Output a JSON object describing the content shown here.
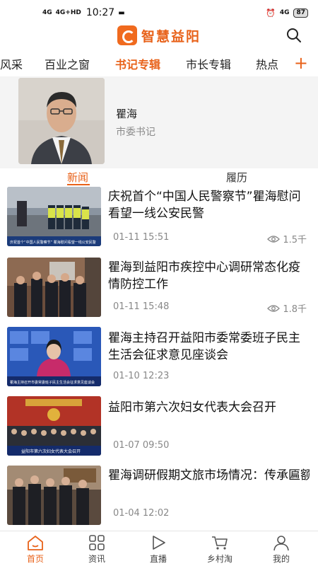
{
  "status_bar": {
    "signal_left": "4G",
    "signal_left2": "4G+HD",
    "time": "10:27",
    "network_right": "4G",
    "battery": "87"
  },
  "header": {
    "app_name": "智慧益阳"
  },
  "tabs": [
    {
      "label": "风采"
    },
    {
      "label": "百业之窗"
    },
    {
      "label": "书记专辑"
    },
    {
      "label": "市长专辑"
    },
    {
      "label": "热点"
    }
  ],
  "tab_add": "+",
  "profile": {
    "name": "瞿海",
    "role": "市委书记"
  },
  "subtabs": [
    {
      "label": "新闻"
    },
    {
      "label": "履历"
    }
  ],
  "news": [
    {
      "title": "庆祝首个“中国人民警察节”瞿海慰问看望一线公安民警",
      "date": "01-11 15:51",
      "views": "1.5千",
      "thumb_caption": "庆祝首个“中国人民警察节” 瞿海慰问看望一线公安民警"
    },
    {
      "title": "瞿海到益阳市疾控中心调研常态化疫情防控工作",
      "date": "01-11 15:48",
      "views": "1.8千"
    },
    {
      "title": "瞿海主持召开益阳市委常委班子民主生活会征求意见座谈会",
      "date": "01-10 12:23",
      "views": "",
      "thumb_caption": "瞿海主持召开市委常委班子民主生活会征求意见座谈会"
    },
    {
      "title": "益阳市第六次妇女代表大会召开",
      "date": "01-07 09:50",
      "views": "",
      "thumb_caption": "益阳市第六次妇女代表大会召开"
    },
    {
      "title": "瞿海调研假期文旅市场情况：传承匾额文化 为东部新区木…",
      "date": "01-04 12:02",
      "views": ""
    }
  ],
  "bottom_nav": [
    {
      "label": "首页"
    },
    {
      "label": "资讯"
    },
    {
      "label": "直播"
    },
    {
      "label": "乡村淘"
    },
    {
      "label": "我的"
    }
  ],
  "colors": {
    "accent": "#e8621a",
    "text": "#222222",
    "muted": "#888888"
  }
}
